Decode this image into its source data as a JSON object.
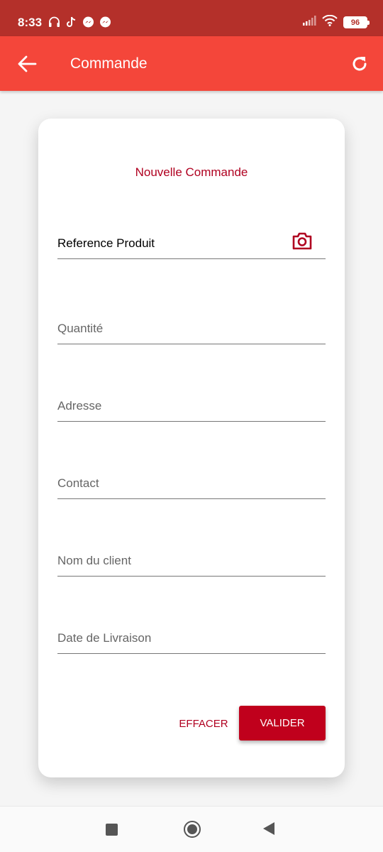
{
  "status_bar": {
    "time": "8:33",
    "battery": "96",
    "icons_left": [
      "headphones-icon",
      "tiktok-icon",
      "messenger-icon",
      "messenger-icon"
    ],
    "icons_right": [
      "signal-icon",
      "wifi-icon",
      "battery-icon"
    ]
  },
  "app_bar": {
    "title": "Commande",
    "background": "#f4463a"
  },
  "form": {
    "title": "Nouvelle Commande",
    "accent": "#b00020",
    "fields": [
      {
        "key": "reference",
        "value": "Reference Produit",
        "placeholder": ""
      },
      {
        "key": "quantite",
        "value": "",
        "placeholder": "Quantité"
      },
      {
        "key": "adresse",
        "value": "",
        "placeholder": "Adresse"
      },
      {
        "key": "contact",
        "value": "",
        "placeholder": "Contact"
      },
      {
        "key": "nom_client",
        "value": "",
        "placeholder": "Nom du client"
      },
      {
        "key": "date_livraison",
        "value": "",
        "placeholder": "Date de Livraison"
      }
    ],
    "clear_label": "EFFACER",
    "submit_label": "VALIDER"
  },
  "nav_bar": {
    "buttons": [
      "recents-button",
      "home-button",
      "back-button"
    ]
  }
}
